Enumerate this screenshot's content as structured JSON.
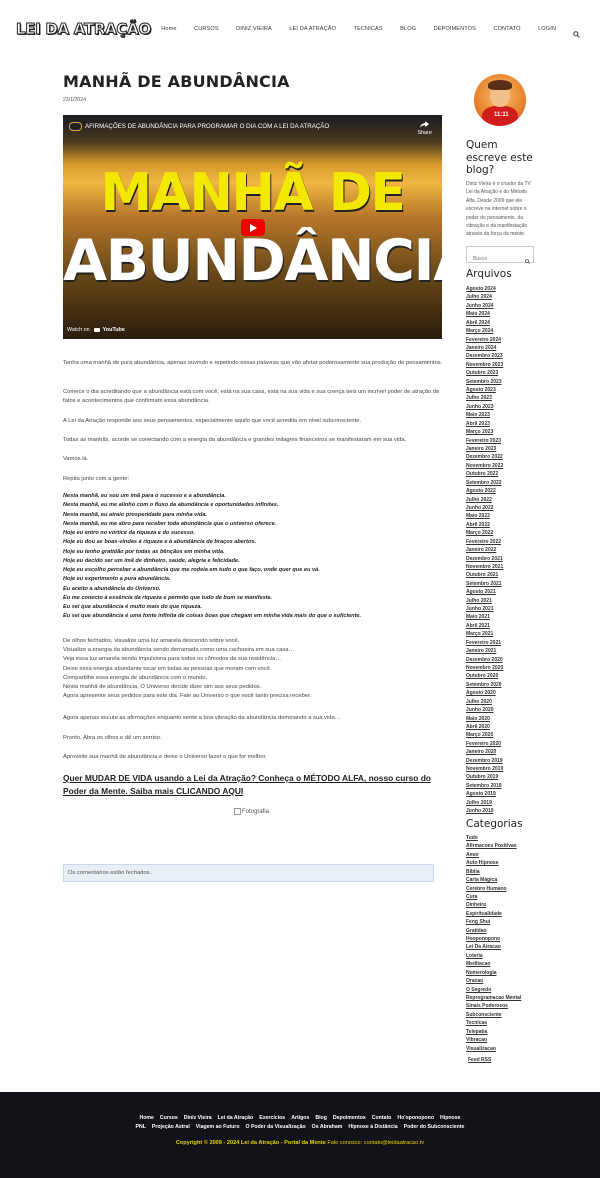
{
  "site": {
    "logo": "LEI DA ATRAÇÃO"
  },
  "nav": [
    "Home",
    "CURSOS",
    "DINIZ VIEIRA",
    "LEI DA ATRAÇÃO",
    "TECNICAS",
    "BLOG",
    "DEPOIMENTOS",
    "CONTATO",
    "LOGIN"
  ],
  "post": {
    "title": "MANHÃ DE ABUNDÂNCIA",
    "date": "23/1/2024",
    "video": {
      "title": "AFIRMAÇÕES DE ABUNDÂNCIA PARA PROGRAMAR O DIA COM A LEI DA ATRAÇÃO",
      "share": "Share",
      "big_line1": "MANHÃ DE",
      "big_line2": "ABUNDÂNCIA",
      "watch_on": "Watch on",
      "youtube": "YouTube"
    },
    "paragraphs": [
      "Tenha uma manhã de pura abundância, apenas ouvindo e repetindo essas palavras que vão afetar poderosamente sua produção de pensamentos.",
      "Comece o dia acreditando que a abundância está com você, está na sua casa, está na sua vida e sua crença terá um incrível poder de atração de fatos e acontecimentos que confirmam essa abundância.",
      "A Lei da Atração responde aos seus pensamentos, especialmente aquilo que você acredita em nível subconsciente.",
      "Todas as manhãs, acorde se conectando com a energia da abundância e grandes milagres financeiros se manifestaram em sua vida.",
      "Vamos lá.",
      "Repita junto com a gente:"
    ],
    "affirmations": [
      "Nesta manhã, eu sou um ímã para o sucesso e a abundância.",
      "Nesta manhã, eu me alinho com o fluxo da abundância e oportunidades infinitas.",
      "Nesta manhã, eu atraio prosperidade para minha vida.",
      "Nesta manhã, eu me abro para receber toda abundância que o universo oferece.",
      "Hoje eu entro no vórtice da riqueza e do sucesso.",
      "Hoje eu dou as boas-vindas à riqueza e à abundância de braços abertos.",
      "Hoje eu tenho gratidão por todas as bênçãos em minha vida.",
      "Hoje eu decido ser um ímã de dinheiro, saúde, alegria e felicidade.",
      "Hoje eu escolho perceber a abundância que me rodeia em tudo o que faço, onde quer que eu vá.",
      "Hoje eu experimento a pura abundância.",
      "Eu aceito a abundância do Universo.",
      "Eu me conecto à essência da riqueza e permito que tudo de bom se manifeste.",
      "Eu sei que abundância é muito mais do que riqueza.",
      "Eu sei que abundância é uma fonte infinita de coisas boas que chegam em minha vida mais do que o suficiente."
    ],
    "visualization": [
      "De olhos fechados, visualize uma luz amarela descendo sobre você.",
      "Visualize a energia da abundância sendo derramada como uma cachoeira em sua casa…",
      "Veja essa luz amarela sendo impulsiona para todos os cômodos da sua residência…",
      "Deixe essa energia abundante tocar em todas as pessoas que moram com você.",
      "Compartilhe essa energia de abundância com o mundo.",
      "Nesta manhã de abundância, O Universo decide dizer sim aos seus pedidos.",
      "Agora apresente seus pedidos para este dia. Fale ao Universo o que você tanto precisa receber."
    ],
    "closing": [
      "Agora apenas escute as afirmações enquanto sente a boa vibração da abundância dominando a sua vida…",
      "Pronto. Abra os olhos e dê um sorriso.",
      "Aproveite sua manhã de abundância e deixe o Universo fazer o que for melhor."
    ],
    "cta": "Quer MUDAR DE VIDA usando a Lei da Atração? Conheça o MÉTODO ALFA, nosso curso do Poder da Mente. Saiba mais CLICANDO AQUI",
    "image_alt": "Fotografia",
    "comments_closed": "Os comentários estão fechados."
  },
  "sidebar": {
    "avatar_text": "11:11",
    "about_title": "Quem escreve este blog?",
    "about_text": "Diniz Vieira é o criador da TV Lei da Atração e do Método Alfa. Desde 2009 que ele escreve na internet sobre o poder do pensamento, da vibração e da manifestação através da força da mente.",
    "search_placeholder": "Busca",
    "archives_title": "Arquivos",
    "archives": [
      "Agosto 2024",
      "Julho 2024",
      "Junho 2024",
      "Maio 2024",
      "Abril 2024",
      "Março 2024",
      "Fevereiro 2024",
      "Janeiro 2024",
      "Dezembro 2023",
      "Novembro 2023",
      "Outubro 2023",
      "Setembro 2023",
      "Agosto 2023",
      "Julho 2023",
      "Junho 2023",
      "Maio 2023",
      "Abril 2023",
      "Março 2023",
      "Fevereiro 2023",
      "Janeiro 2023",
      "Dezembro 2022",
      "Novembro 2022",
      "Outubro 2022",
      "Setembro 2022",
      "Agosto 2022",
      "Julho 2022",
      "Junho 2022",
      "Maio 2022",
      "Abril 2022",
      "Março 2022",
      "Fevereiro 2022",
      "Janeiro 2022",
      "Dezembro 2021",
      "Novembro 2021",
      "Outubro 2021",
      "Setembro 2021",
      "Agosto 2021",
      "Julho 2021",
      "Junho 2021",
      "Maio 2021",
      "Abril 2021",
      "Março 2021",
      "Fevereiro 2021",
      "Janeiro 2021",
      "Dezembro 2020",
      "Novembro 2020",
      "Outubro 2020",
      "Setembro 2020",
      "Agosto 2020",
      "Julho 2020",
      "Junho 2020",
      "Maio 2020",
      "Abril 2020",
      "Março 2020",
      "Fevereiro 2020",
      "Janeiro 2020",
      "Dezembro 2019",
      "Novembro 2019",
      "Outubro 2019",
      "Setembro 2019",
      "Agosto 2019",
      "Julho 2019",
      "Junho 2019"
    ],
    "categories_title": "Categorias",
    "categories": [
      "Tudo",
      "Afirmacoes Positivas",
      "Amor",
      "Auto Hipnose",
      "Bíblia",
      "Carta Mágica",
      "Cerebro Humano",
      "Cura",
      "Dinheiro",
      "Espiritualidade",
      "Feng Shui",
      "Gratidao",
      "Hooponopono",
      "Lei Da Atracao",
      "Loteria",
      "Meditacao",
      "Numerologia",
      "Oracao",
      "O Segredo",
      "Reprogramacao Mental",
      "Sinais Poderosos",
      "Subconsciente",
      "Tecnicas",
      "Telepatia",
      "Vibracao",
      "Visualizacao"
    ],
    "feed": "Feed RSS"
  },
  "footer": {
    "row1": [
      "Home",
      "Cursos",
      "Diniz Vieira",
      "Lei da Atração",
      "Exercícios",
      "Artigos",
      "Blog",
      "Depoimentos",
      "Contato",
      "Ho'oponopono",
      "Hipnose"
    ],
    "row2": [
      "PNL",
      "Projeção Astral",
      "Viagem ao Futuro",
      "O Poder da Visualização",
      "Os Abraham",
      "Hipnose à Distância",
      "Poder do Subconsciente"
    ],
    "copyright": "Copyright © 2009 - 2024 Lei da Atração - Portal da Mente",
    "contact": "Fale conosco: contato@leidaatracao.tv"
  }
}
